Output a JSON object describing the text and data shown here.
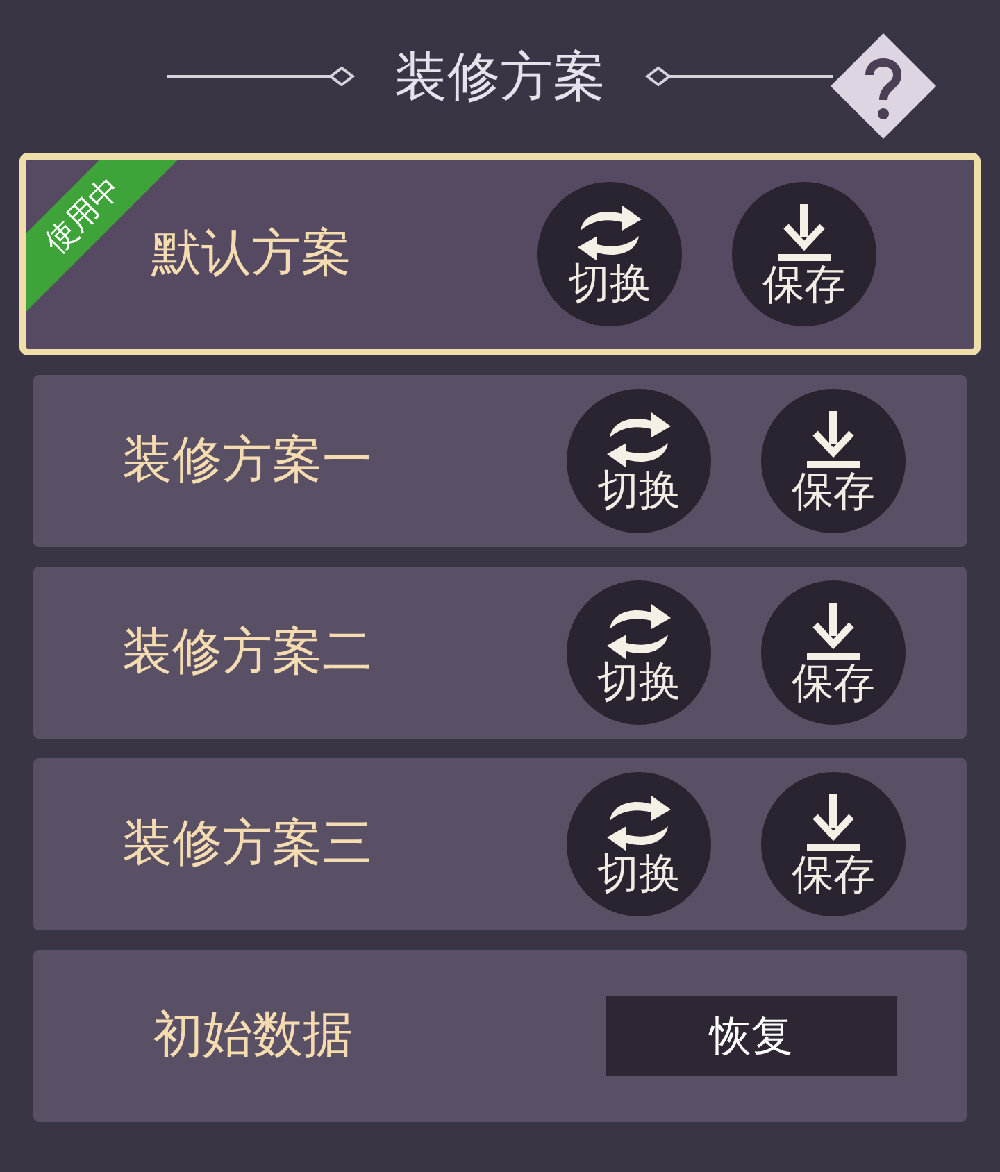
{
  "title": "装修方案",
  "in_use_badge": "使用中",
  "plans": [
    {
      "name": "默认方案",
      "selected": true,
      "switch_label": "切换",
      "save_label": "保存"
    },
    {
      "name": "装修方案一",
      "selected": false,
      "switch_label": "切换",
      "save_label": "保存"
    },
    {
      "name": "装修方案二",
      "selected": false,
      "switch_label": "切换",
      "save_label": "保存"
    },
    {
      "name": "装修方案三",
      "selected": false,
      "switch_label": "切换",
      "save_label": "保存"
    }
  ],
  "reset": {
    "label": "初始数据",
    "button": "恢复"
  }
}
